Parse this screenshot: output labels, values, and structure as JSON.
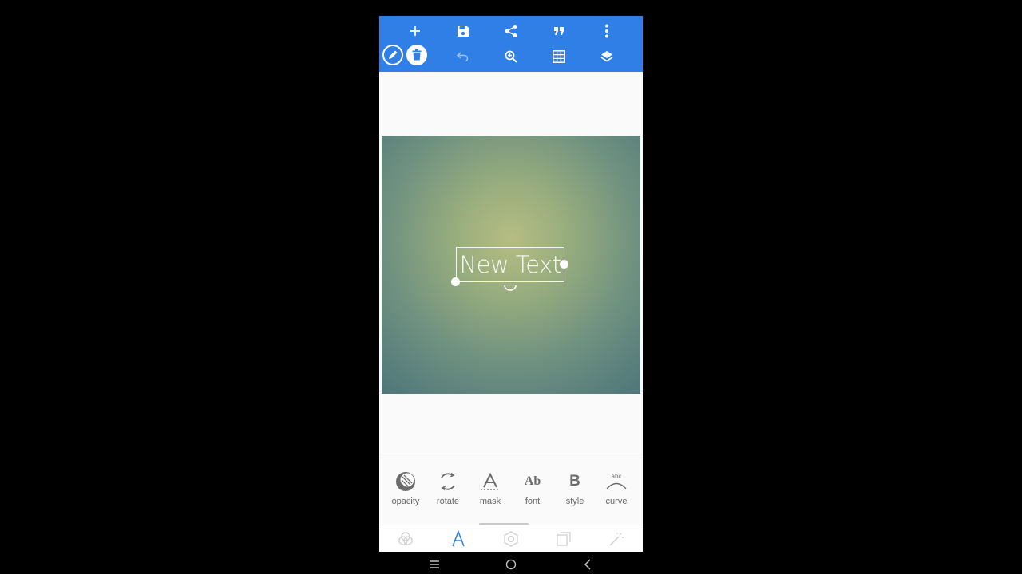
{
  "canvas": {
    "text_layer": "New Text"
  },
  "tools": [
    {
      "label": "opacity",
      "icon": "opacity-icon"
    },
    {
      "label": "rotate",
      "icon": "rotate-icon"
    },
    {
      "label": "mask",
      "icon": "mask-icon"
    },
    {
      "label": "font",
      "icon": "font-icon",
      "glyph": "Ab"
    },
    {
      "label": "style",
      "icon": "bold-icon",
      "glyph": "B"
    },
    {
      "label": "curve",
      "icon": "curve-text-icon",
      "glyph": "abc"
    }
  ],
  "topbar_icons": [
    "add-icon",
    "save-icon",
    "share-icon",
    "quote-icon",
    "more-vert-icon",
    "pencil-icon",
    "delete-icon",
    "undo-icon",
    "zoom-icon",
    "grid-icon",
    "layers-icon"
  ],
  "bottom_nav_icons": [
    "blend-icon",
    "text-icon",
    "shape-icon",
    "clone-icon",
    "magic-wand-icon"
  ],
  "colors": {
    "topbar": "#2f7fe6",
    "active_accent": "#2f7fe6",
    "inactive_icon": "#cfcfcf"
  }
}
